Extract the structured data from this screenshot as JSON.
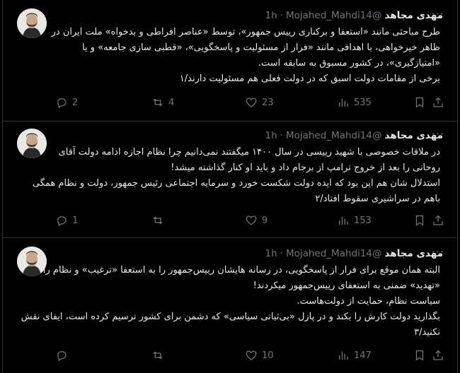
{
  "tweets": [
    {
      "name": "مهدی مجاهد",
      "handle": "@Mojahed_Mahdi14",
      "dot": "·",
      "time": "1h",
      "lines": [
        "طرح مباحثی مانند «استعفا و برکناری رییس جمهور»، توسط «عناصر افراطی و بدخواه» ملت ایران در",
        "ظاهر خیرخواهی، با اهدافی مانند «فرار از مسئولیت و پاسخگویی»، «قطبی سازی جامعه» و یا",
        "«امتیازگیری»، در کشور مسبوق به سابقه است.",
        "برخی از مقامات دولت اسبق که در دولت فعلی هم مسئولیت دارند/۱"
      ],
      "replies": "2",
      "reposts": "4",
      "likes": "23",
      "views": "535"
    },
    {
      "name": "مهدی مجاهد",
      "handle": "@Mojahed_Mahdi14",
      "dot": "·",
      "time": "1h",
      "lines": [
        "در ملاقات خصوصی با شهید رییسی در سال ۱۴۰۰ میگفتند نمی‌دانیم چرا نظام اجازه ادامه دولت آقای",
        "روحانی را بعد از خروج ترامپ از برجام داد و باید او کنار گذاشته میشد!",
        "استدلال شان هم این بود که ایده دولت شکست خورد و سرمایه اجتماعی رئیس جمهور، دولت و نظام همگی",
        "باهم در سراشیری سقوط افتاد/۲"
      ],
      "replies": "1",
      "reposts": "",
      "likes": "9",
      "views": "153"
    },
    {
      "name": "مهدی مجاهد",
      "handle": "@Mojahed_Mahdi14",
      "dot": "·",
      "time": "1h",
      "lines": [
        "البته همان موقع برای فرار از پاسخگویی، در رسانه هایشان رییس‌جمهور را به استعفا «ترغیب» و نظام را",
        "«تهدید» ضمنی به استعفای رییس‌جمهور میکردند!",
        "سیاست نظام، حمایت از دولت‌هاست.",
        "بگذارید دولت کارش را بکند و در پازل «بی‌ثباتی سیاسی» که دشمن برای کشور ترسیم کرده است، ایفای نقش",
        "نکنید/۳"
      ],
      "replies": "",
      "reposts": "",
      "likes": "10",
      "views": "147"
    }
  ]
}
